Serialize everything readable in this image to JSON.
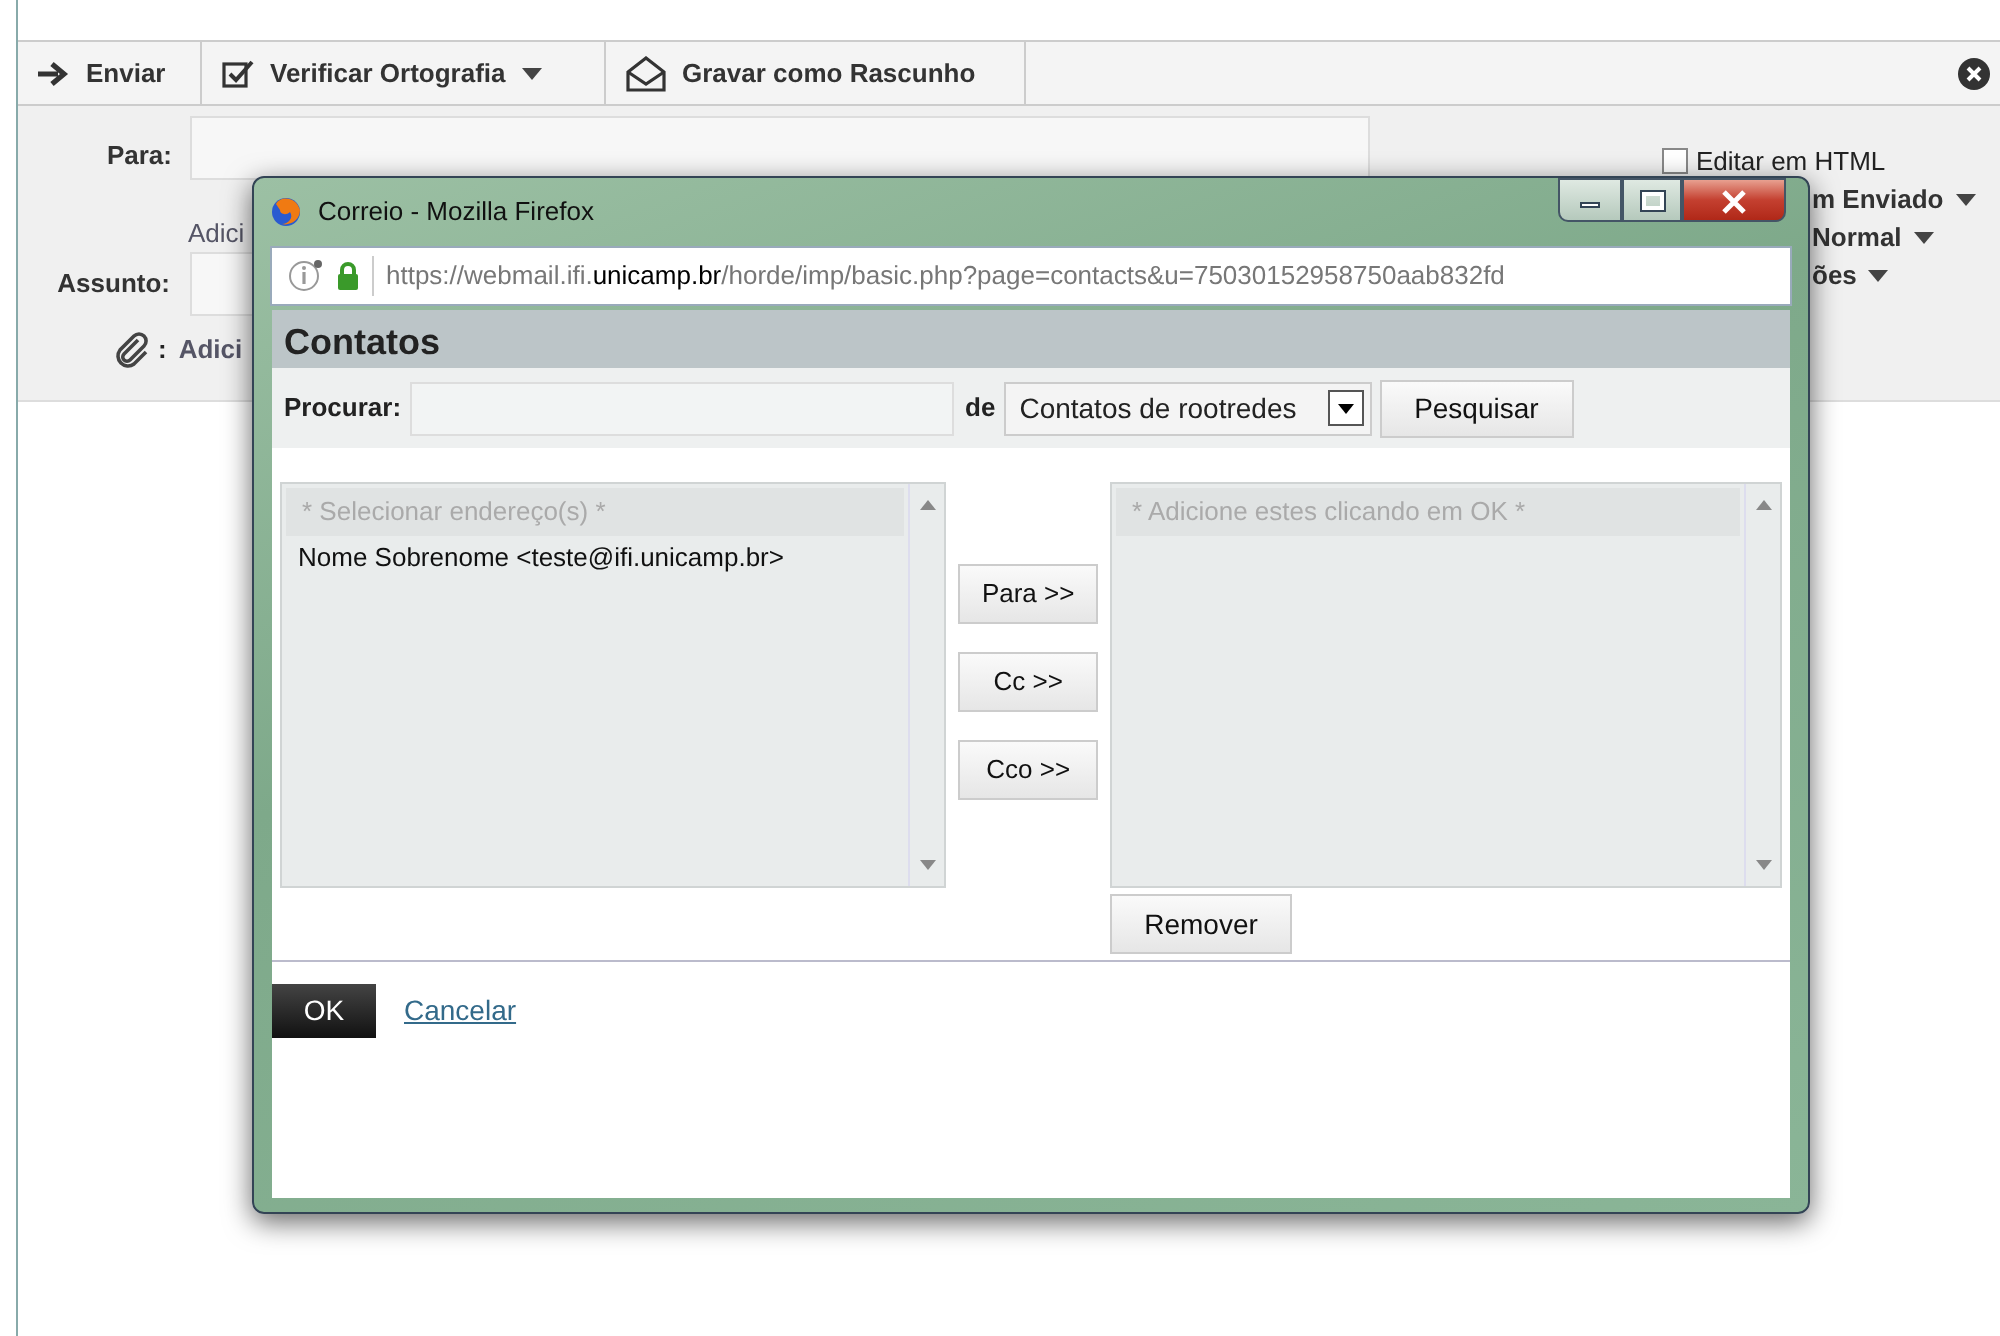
{
  "toolbar": [
    {
      "kind": "send",
      "label": "Enviar",
      "dropdown": false
    },
    {
      "kind": "spell",
      "label": "Verificar Ortografia",
      "dropdown": true
    },
    {
      "kind": "draft",
      "label": "Gravar como Rascunho",
      "dropdown": false
    }
  ],
  "compose": {
    "to_label": "Para:",
    "to_link": "Adici",
    "subject_label": "Assunto:",
    "attach_separator": ":",
    "attach_link": "Adici",
    "options": [
      {
        "kind": "checkbox",
        "label": "Editar em HTML",
        "checked": false
      },
      {
        "kind": "dropdown",
        "label": "m Enviado"
      },
      {
        "kind": "dropdown",
        "label": "Normal"
      },
      {
        "kind": "dropdown",
        "label": "ões"
      }
    ]
  },
  "popup": {
    "title": "Correio - Mozilla Firefox",
    "url": "https://webmail.ifi.**unicamp.br**/horde/imp/basic.php?page=contacts&u=75030152958750aab832fd",
    "heading": "Contatos",
    "search_label": "Procurar:",
    "source_label": "de",
    "source": "Contatos de rootredes",
    "search_button": "Pesquisar",
    "source_list": {
      "header": "* Selecionar endereço(s) *",
      "items": [
        {
          "text": "Nome Sobrenome <teste@ifi.unicamp.br>",
          "selected": false
        }
      ]
    },
    "add_buttons": [
      "Para >>",
      "Cc >>",
      "Cco >>"
    ],
    "target_list": {
      "header": "* Adicione estes clicando em OK *"
    },
    "remove_button": "Remover",
    "ok_button": "OK",
    "cancel_link": "Cancelar"
  }
}
